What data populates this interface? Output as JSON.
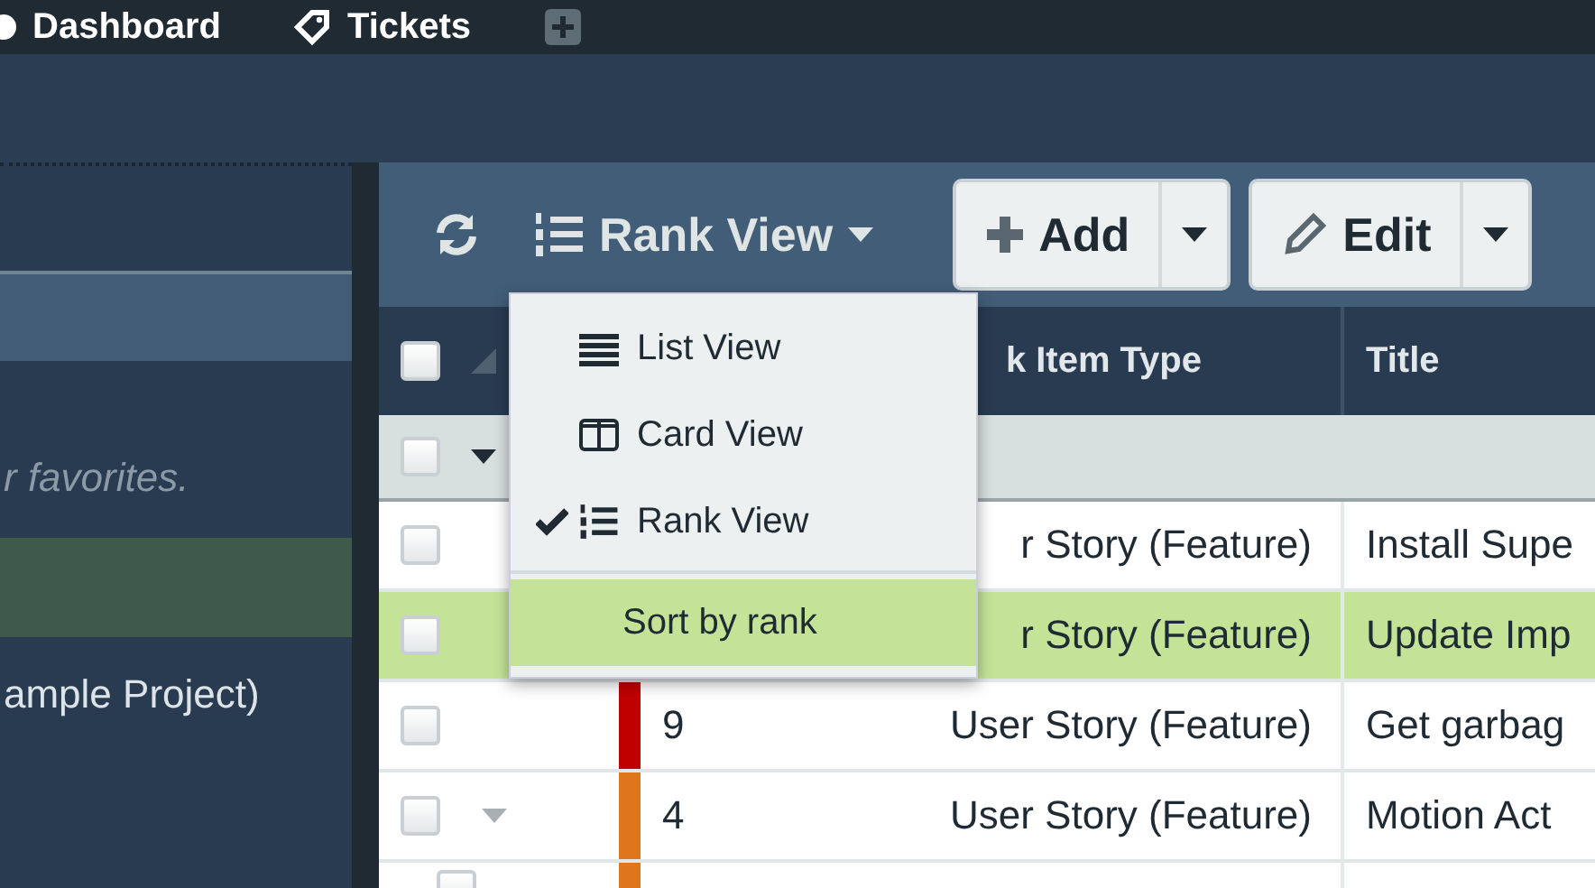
{
  "nav": {
    "items": [
      {
        "label": "Dashboard"
      },
      {
        "label": "Tickets"
      }
    ]
  },
  "sidebar": {
    "items": [
      {
        "kind": "bar",
        "selected": false
      },
      {
        "kind": "hint",
        "label": "r favorites."
      },
      {
        "kind": "bar",
        "selected": true
      },
      {
        "kind": "item",
        "label": "ample Project)"
      }
    ]
  },
  "toolbar": {
    "view_button": "Rank View",
    "add_button": "Add",
    "edit_button": "Edit"
  },
  "view_menu": [
    {
      "label": "List View",
      "checked": false,
      "selected": false
    },
    {
      "label": "Card View",
      "checked": false,
      "selected": false
    },
    {
      "label": "Rank View",
      "checked": true,
      "selected": false
    },
    {
      "label": "Sort by rank",
      "checked": false,
      "selected": true
    }
  ],
  "table": {
    "select_all": {
      "checked": false
    },
    "columns": [
      "k Item Type",
      "Title"
    ],
    "group_row": {
      "expanded": true,
      "checked": false
    },
    "rows": [
      {
        "type": "r Story (Feature)",
        "title": "Install Supe",
        "checked": false,
        "selected": false,
        "expandable": false
      },
      {
        "type": "r Story (Feature)",
        "title": "Update Imp",
        "checked": false,
        "selected": true,
        "expandable": false
      },
      {
        "rank": "9",
        "type": "User Story (Feature)",
        "title": "Get garbag",
        "color": "#c00000",
        "checked": false,
        "selected": false,
        "expandable": false
      },
      {
        "rank": "4",
        "type": "User Story (Feature)",
        "title": "Motion Act",
        "color": "#e0761c",
        "checked": false,
        "selected": false,
        "expandable": true
      },
      {
        "color": "#e0761c",
        "checked": false,
        "selected": false,
        "child": true
      }
    ]
  }
}
